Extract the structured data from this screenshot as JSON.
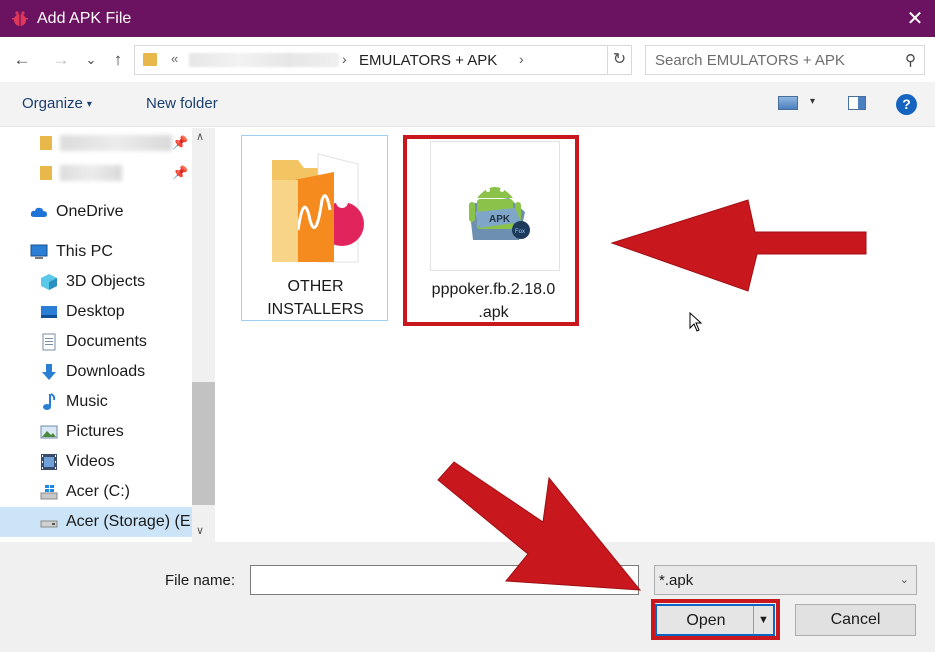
{
  "window": {
    "title": "Add APK File",
    "close_glyph": "✕"
  },
  "nav": {
    "back_glyph": "←",
    "forward_glyph": "→",
    "recent_glyph": "⌄",
    "up_glyph": "↑"
  },
  "address": {
    "prefix": "«",
    "current_folder": "EMULATORS + APK",
    "separator": "›",
    "refresh_glyph": "↻"
  },
  "search": {
    "placeholder": "Search EMULATORS + APK",
    "icon_glyph": "⚲"
  },
  "toolbar": {
    "organize_label": "Organize",
    "caret": "▾",
    "new_folder_label": "New folder",
    "help_label": "?"
  },
  "sidebar": {
    "items": [
      {
        "label": "OneDrive"
      },
      {
        "label": "This PC"
      },
      {
        "label": "3D Objects"
      },
      {
        "label": "Desktop"
      },
      {
        "label": "Documents"
      },
      {
        "label": "Downloads"
      },
      {
        "label": "Music"
      },
      {
        "label": "Pictures"
      },
      {
        "label": "Videos"
      },
      {
        "label": "Acer (C:)"
      },
      {
        "label": "Acer (Storage) (E"
      }
    ],
    "pin_glyph": "📌",
    "scroll_up": "∧",
    "scroll_down": "∨"
  },
  "files": [
    {
      "label_line1": "OTHER",
      "label_line2": "INSTALLERS",
      "icon": "folder-icon"
    },
    {
      "label_line1": "pppoker.fb.2.18.0",
      "label_line2": ".apk",
      "icon": "apk-file-icon"
    }
  ],
  "footer": {
    "file_name_label": "File name:",
    "file_name_value": "",
    "filter_value": "*.apk",
    "filter_caret": "⌄",
    "open_label": "Open",
    "open_split_glyph": "▼",
    "cancel_label": "Cancel"
  },
  "colors": {
    "titlebar": "#6b1260",
    "highlight": "#c9171e",
    "accent": "#0a66c2"
  }
}
